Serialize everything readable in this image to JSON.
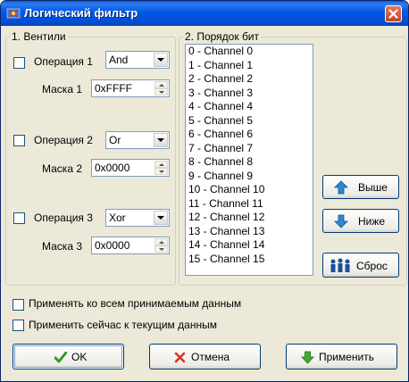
{
  "window": {
    "title": "Логический фильтр",
    "titlebar_color": "#0058e6",
    "face_color": "#ece9d8"
  },
  "gates": {
    "legend": "1. Вентили",
    "rows": [
      {
        "op_label": "Операция 1",
        "op_value": "And",
        "mask_label": "Маска 1",
        "mask_value": "0xFFFF",
        "checked": false
      },
      {
        "op_label": "Операция 2",
        "op_value": "Or",
        "mask_label": "Маска 2",
        "mask_value": "0x0000",
        "checked": false
      },
      {
        "op_label": "Операция 3",
        "op_value": "Xor",
        "mask_label": "Маска 3",
        "mask_value": "0x0000",
        "checked": false
      }
    ]
  },
  "bit_order": {
    "legend": "2. Порядок бит",
    "items": [
      "0 - Channel 0",
      "1 - Channel 1",
      "2 - Channel 2",
      "3 - Channel 3",
      "4 - Channel 4",
      "5 - Channel 5",
      "6 - Channel 6",
      "7 - Channel 7",
      "8 - Channel 8",
      "9 - Channel 9",
      "10 - Channel 10",
      "11 - Channel 11",
      "12 - Channel 12",
      "13 - Channel 13",
      "14 - Channel 14",
      "15 - Channel 15"
    ]
  },
  "side_buttons": {
    "up": {
      "label": "Выше",
      "icon": "arrow-up-icon"
    },
    "down": {
      "label": "Ниже",
      "icon": "arrow-down-icon"
    },
    "reset": {
      "label": "Сброс",
      "icon": "people-icon"
    }
  },
  "options": {
    "apply_all": {
      "label": "Применять ко всем принимаемым данным",
      "checked": false
    },
    "apply_now": {
      "label": "Применить сейчас к текущим данным",
      "checked": false
    }
  },
  "footer": {
    "ok": {
      "label": "OK",
      "icon": "checkmark-icon"
    },
    "cancel": {
      "label": "Отмена",
      "icon": "cross-icon"
    },
    "apply": {
      "label": "Применить",
      "icon": "arrow-down-green-icon"
    }
  }
}
